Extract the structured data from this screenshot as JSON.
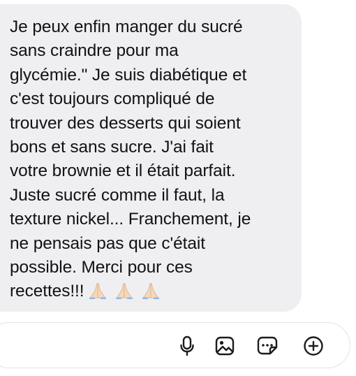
{
  "message": {
    "lines": [
      "Je peux enfin manger du sucré",
      "sans craindre pour ma",
      "glycémie.\" Je suis diabétique et",
      "c'est toujours compliqué de",
      "trouver des desserts qui soient",
      "bons et sans sucre. J'ai fait",
      "votre brownie et il était parfait.",
      "Juste sucré comme il faut, la",
      "texture nickel... Franchement, je",
      "ne pensais pas que c'était",
      "possible. Merci pour ces",
      "recettes!!!"
    ],
    "emoji": [
      "folded-hands-icon",
      "folded-hands-icon",
      "folded-hands-icon"
    ]
  },
  "composer": {
    "input_value": "",
    "icons": [
      "microphone-icon",
      "image-icon",
      "sticker-icon",
      "add-icon"
    ]
  },
  "colors": {
    "bubble": "#efeff1",
    "text": "#121214",
    "icon": "#1c1c1e",
    "emoji": "#f6d7b8"
  }
}
